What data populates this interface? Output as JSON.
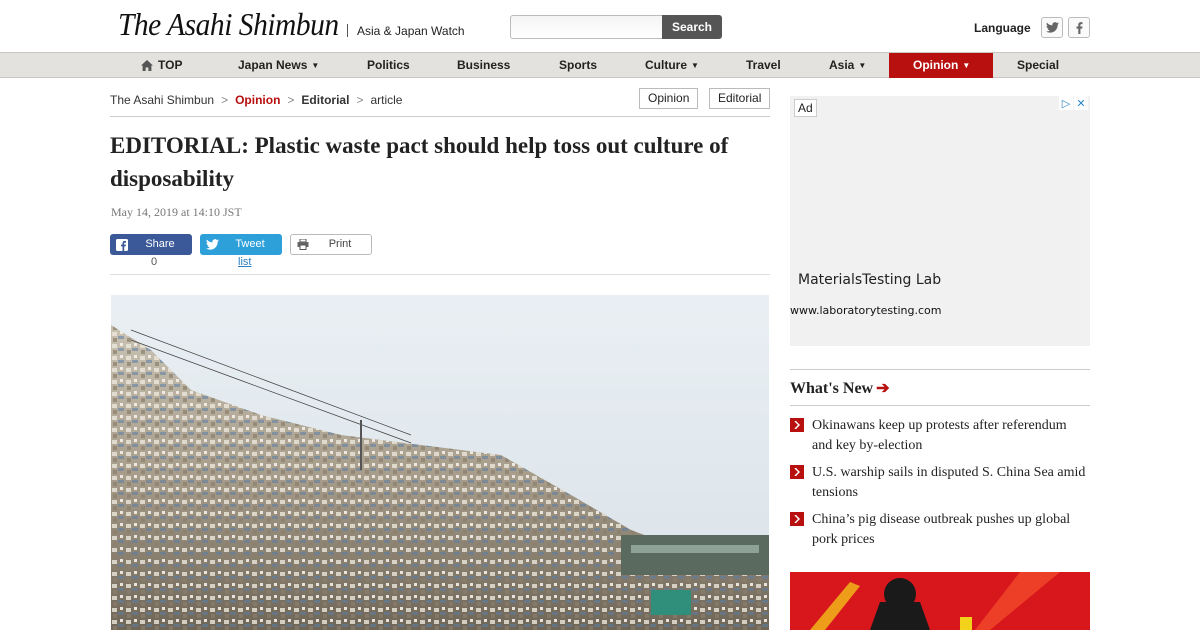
{
  "header": {
    "logo": "The Asahi Shimbun",
    "sub": "Asia & Japan Watch",
    "search_button": "Search",
    "search_placeholder": "",
    "language": "Language"
  },
  "nav": [
    {
      "label": "TOP"
    },
    {
      "label": "Japan News"
    },
    {
      "label": "Politics"
    },
    {
      "label": "Business"
    },
    {
      "label": "Sports"
    },
    {
      "label": "Culture"
    },
    {
      "label": "Travel"
    },
    {
      "label": "Asia"
    },
    {
      "label": "Opinion"
    },
    {
      "label": "Special"
    }
  ],
  "breadcrumb": [
    "The Asahi Shimbun",
    "Opinion",
    "Editorial",
    "article"
  ],
  "tags": [
    "Opinion",
    "Editorial"
  ],
  "article": {
    "title": "EDITORIAL: Plastic waste pact should help toss out culture of disposability",
    "date": "May 14, 2019 at 14:10 JST"
  },
  "share": {
    "facebook": "Share",
    "facebook_count": "0",
    "twitter": "Tweet",
    "twitter_link": "list",
    "print": "Print"
  },
  "ad": {
    "badge": "Ad",
    "title": "MaterialsTesting Lab",
    "url": "www.laboratorytesting.com"
  },
  "whats_new": {
    "heading": "What's New",
    "items": [
      "Okinawans keep up protests after referendum and key by-election",
      "U.S. warship sails in disputed S. China Sea amid tensions",
      "China’s pig disease outbreak pushes up global pork prices"
    ]
  },
  "colors": {
    "accent": "#b80f0f",
    "nav_bg": "#e3e2de",
    "facebook": "#3b5998",
    "twitter": "#2d9fd9"
  }
}
